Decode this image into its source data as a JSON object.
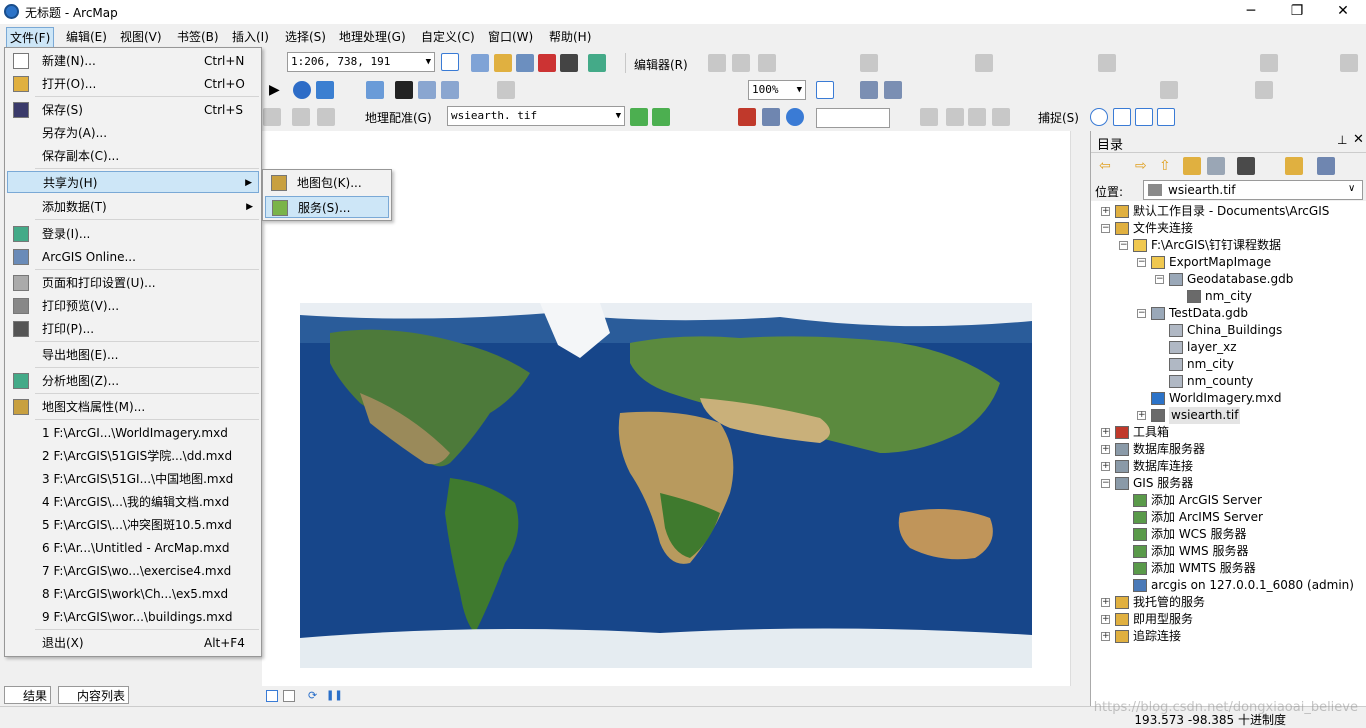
{
  "title": "无标题 - ArcMap",
  "window_controls": [
    "─",
    "❐",
    "✕"
  ],
  "menubar": [
    "文件(F)",
    "编辑(E)",
    "视图(V)",
    "书签(B)",
    "插入(I)",
    "选择(S)",
    "地理处理(G)",
    "自定义(C)",
    "窗口(W)",
    "帮助(H)"
  ],
  "toolbar": {
    "scale": "1:206, 738, 191",
    "editor_label": "编辑器(R)",
    "zoom": "100%",
    "georef_label": "地理配准(G)",
    "raster_layer": "wsiearth. tif",
    "snap_label": "捕捉(S)"
  },
  "file_menu": [
    {
      "label": "新建(N)...",
      "shortcut": "Ctrl+N",
      "icon": "new-doc-icon"
    },
    {
      "label": "打开(O)...",
      "shortcut": "Ctrl+O",
      "icon": "open-folder-icon"
    },
    {
      "label": "保存(S)",
      "shortcut": "Ctrl+S",
      "icon": "save-icon"
    },
    {
      "label": "另存为(A)...",
      "shortcut": ""
    },
    {
      "label": "保存副本(C)...",
      "shortcut": ""
    },
    {
      "label": "共享为(H)",
      "shortcut": "",
      "submenu": true
    },
    {
      "label": "添加数据(T)",
      "shortcut": "",
      "submenu": true
    },
    {
      "label": "登录(I)...",
      "shortcut": "",
      "icon": "signin-icon"
    },
    {
      "label": "ArcGIS Online...",
      "shortcut": "",
      "icon": "arcgis-online-icon"
    },
    {
      "label": "页面和打印设置(U)...",
      "shortcut": "",
      "icon": "page-setup-icon"
    },
    {
      "label": "打印预览(V)...",
      "shortcut": "",
      "icon": "print-preview-icon"
    },
    {
      "label": "打印(P)...",
      "shortcut": "",
      "icon": "print-icon"
    },
    {
      "label": "导出地图(E)...",
      "shortcut": ""
    },
    {
      "label": "分析地图(Z)...",
      "shortcut": "",
      "icon": "analyze-map-icon"
    },
    {
      "label": "地图文档属性(M)...",
      "shortcut": "",
      "icon": "map-props-icon"
    },
    {
      "label": "1 F:\\ArcGI...\\WorldImagery.mxd",
      "shortcut": ""
    },
    {
      "label": "2 F:\\ArcGIS\\51GIS学院...\\dd.mxd",
      "shortcut": ""
    },
    {
      "label": "3 F:\\ArcGIS\\51GI...\\中国地图.mxd",
      "shortcut": ""
    },
    {
      "label": "4 F:\\ArcGIS\\...\\我的编辑文档.mxd",
      "shortcut": ""
    },
    {
      "label": "5 F:\\ArcGIS\\...\\冲突图斑10.5.mxd",
      "shortcut": ""
    },
    {
      "label": "6 F:\\Ar...\\Untitled - ArcMap.mxd",
      "shortcut": ""
    },
    {
      "label": "7 F:\\ArcGIS\\wo...\\exercise4.mxd",
      "shortcut": ""
    },
    {
      "label": "8 F:\\ArcGIS\\work\\Ch...\\ex5.mxd",
      "shortcut": ""
    },
    {
      "label": "9 F:\\ArcGIS\\wor...\\buildings.mxd",
      "shortcut": ""
    },
    {
      "label": "退出(X)",
      "shortcut": "Alt+F4"
    }
  ],
  "share_submenu": [
    {
      "label": "地图包(K)...",
      "icon": "map-package-icon"
    },
    {
      "label": "服务(S)...",
      "icon": "service-icon"
    }
  ],
  "catalog": {
    "title": "目录",
    "location_label": "位置:",
    "location_value": "wsiearth.tif",
    "tree": [
      {
        "label": "默认工作目录 - Documents\\ArcGIS",
        "level": 0,
        "exp": "+",
        "icon": "home-folder-icon"
      },
      {
        "label": "文件夹连接",
        "level": 0,
        "exp": "−",
        "icon": "folder-connection-icon"
      },
      {
        "label": "F:\\ArcGIS\\钉钉课程数据",
        "level": 1,
        "exp": "−",
        "icon": "folder-icon"
      },
      {
        "label": "ExportMapImage",
        "level": 2,
        "exp": "−",
        "icon": "folder-icon"
      },
      {
        "label": "Geodatabase.gdb",
        "level": 3,
        "exp": "−",
        "icon": "gdb-icon"
      },
      {
        "label": "nm_city",
        "level": 4,
        "exp": "",
        "icon": "raster-icon"
      },
      {
        "label": "TestData.gdb",
        "level": 2,
        "exp": "−",
        "icon": "gdb-icon"
      },
      {
        "label": "China_Buildings",
        "level": 3,
        "exp": "",
        "icon": "feature-class-icon"
      },
      {
        "label": "layer_xz",
        "level": 3,
        "exp": "",
        "icon": "feature-class-icon"
      },
      {
        "label": "nm_city",
        "level": 3,
        "exp": "",
        "icon": "feature-class-icon"
      },
      {
        "label": "nm_county",
        "level": 3,
        "exp": "",
        "icon": "feature-class-icon"
      },
      {
        "label": "WorldImagery.mxd",
        "level": 2,
        "exp": "",
        "icon": "mxd-icon"
      },
      {
        "label": "wsiearth.tif",
        "level": 2,
        "exp": "+",
        "icon": "raster-icon",
        "selected": true
      },
      {
        "label": "工具箱",
        "level": 0,
        "exp": "+",
        "icon": "toolbox-icon"
      },
      {
        "label": "数据库服务器",
        "level": 0,
        "exp": "+",
        "icon": "db-server-icon"
      },
      {
        "label": "数据库连接",
        "level": 0,
        "exp": "+",
        "icon": "db-connection-icon"
      },
      {
        "label": "GIS 服务器",
        "level": 0,
        "exp": "−",
        "icon": "gis-server-icon"
      },
      {
        "label": "添加 ArcGIS Server",
        "level": 1,
        "exp": "",
        "icon": "add-server-icon"
      },
      {
        "label": "添加 ArcIMS Server",
        "level": 1,
        "exp": "",
        "icon": "add-server-icon"
      },
      {
        "label": "添加 WCS 服务器",
        "level": 1,
        "exp": "",
        "icon": "add-server-icon"
      },
      {
        "label": "添加 WMS 服务器",
        "level": 1,
        "exp": "",
        "icon": "add-server-icon"
      },
      {
        "label": "添加 WMTS 服务器",
        "level": 1,
        "exp": "",
        "icon": "add-server-icon"
      },
      {
        "label": "arcgis on 127.0.0.1_6080 (admin)",
        "level": 1,
        "exp": "",
        "icon": "server-connection-icon"
      },
      {
        "label": "我托管的服务",
        "level": 0,
        "exp": "+",
        "icon": "hosted-services-icon"
      },
      {
        "label": "即用型服务",
        "level": 0,
        "exp": "+",
        "icon": "ready-services-icon"
      },
      {
        "label": "追踪连接",
        "level": 0,
        "exp": "+",
        "icon": "tracking-connection-icon"
      }
    ]
  },
  "bottom_tabs": [
    "结果",
    "内容列表"
  ],
  "status": {
    "coords": "193.573  -98.385 十进制度"
  },
  "watermark": "https://blog.csdn.net/dongxiaoai_believe",
  "colors": {
    "highlight": "#cde6f7",
    "highlight_border": "#7aa9d6",
    "ocean": "#1b4f93"
  }
}
